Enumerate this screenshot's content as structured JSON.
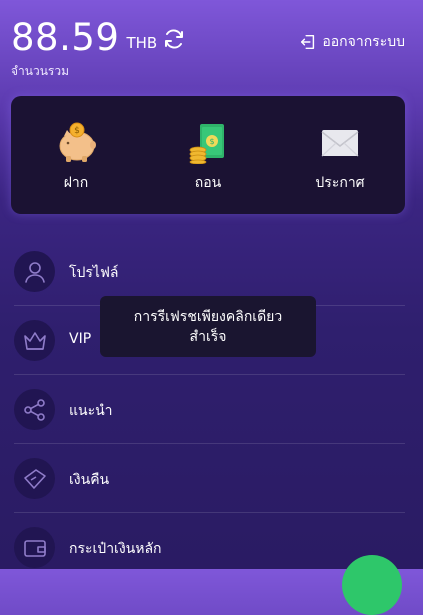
{
  "header": {
    "balance": "88.59",
    "currency": "THB",
    "total_label": "จำนวนรวม",
    "logout_label": "ออกจากระบบ"
  },
  "actions": [
    {
      "label": "ฝาก",
      "icon": "piggy-bank-icon"
    },
    {
      "label": "ถอน",
      "icon": "money-coins-icon"
    },
    {
      "label": "ประกาศ",
      "icon": "envelope-icon"
    }
  ],
  "menu": [
    {
      "label": "โปรไฟล์",
      "icon": "user-icon"
    },
    {
      "label": "VIP",
      "icon": "crown-icon"
    },
    {
      "label": "แนะนำ",
      "icon": "share-icon"
    },
    {
      "label": "เงินคืน",
      "icon": "ticket-icon"
    },
    {
      "label": "กระเป๋าเงินหลัก",
      "icon": "wallet-icon"
    }
  ],
  "toast": {
    "line1": "การรีเฟรชเพียงคลิกเดียว",
    "line2": "สำเร็จ"
  },
  "colors": {
    "accent": "#7f57d9",
    "background": "#2a1b63",
    "card": "#1b1233",
    "fab": "#2ec76a"
  }
}
